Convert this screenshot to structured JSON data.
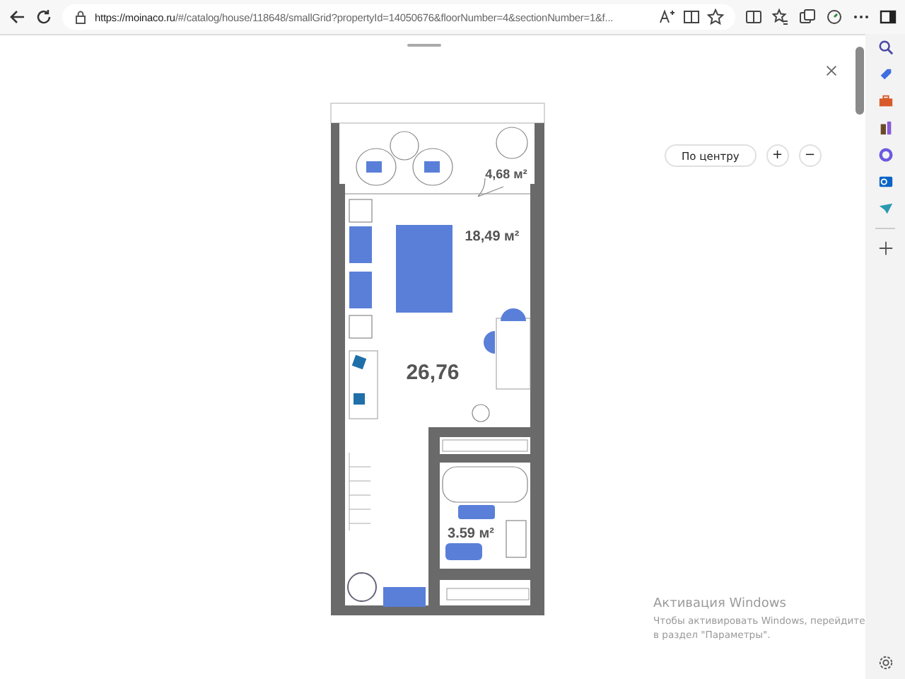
{
  "browser": {
    "url_host": "https://moinaco.ru",
    "url_path": "/#/catalog/house/118648/smallGrid?propertyId=14050676&floorNumber=4&sectionNumber=1&f..."
  },
  "plan_controls": {
    "center_button": "По центру",
    "zoom_in": "+",
    "zoom_out": "−"
  },
  "floor_plan": {
    "areas": [
      {
        "kind": "balcony",
        "label": "4,68 м²"
      },
      {
        "kind": "room",
        "label": "18,49 м²"
      },
      {
        "kind": "total",
        "label": "26,76"
      },
      {
        "kind": "bathroom",
        "label": "3.59 м²"
      }
    ]
  },
  "activation": {
    "title": "Активация Windows",
    "text": "Чтобы активировать Windows, перейдите в раздел \"Параметры\"."
  }
}
